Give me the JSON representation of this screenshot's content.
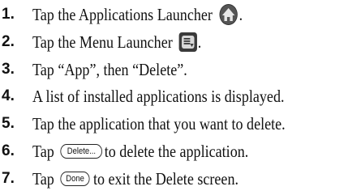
{
  "steps": [
    {
      "number": "1.",
      "pre": "Tap the Applications Launcher",
      "post": "."
    },
    {
      "number": "2.",
      "pre": "Tap the Menu Launcher",
      "post": "."
    },
    {
      "number": "3.",
      "text": "Tap “App”, then “Delete”."
    },
    {
      "number": "4.",
      "text": "A list of installed applications is displayed."
    },
    {
      "number": "5.",
      "text": "Tap the application that you want to delete."
    },
    {
      "number": "6.",
      "pre": "Tap",
      "button": "Delete...",
      "post": "to delete the application."
    },
    {
      "number": "7.",
      "pre": "Tap",
      "button": "Done",
      "post": "to exit the Delete screen."
    }
  ],
  "icons": {
    "applications_launcher": "home-icon",
    "menu_launcher": "menu-icon"
  }
}
